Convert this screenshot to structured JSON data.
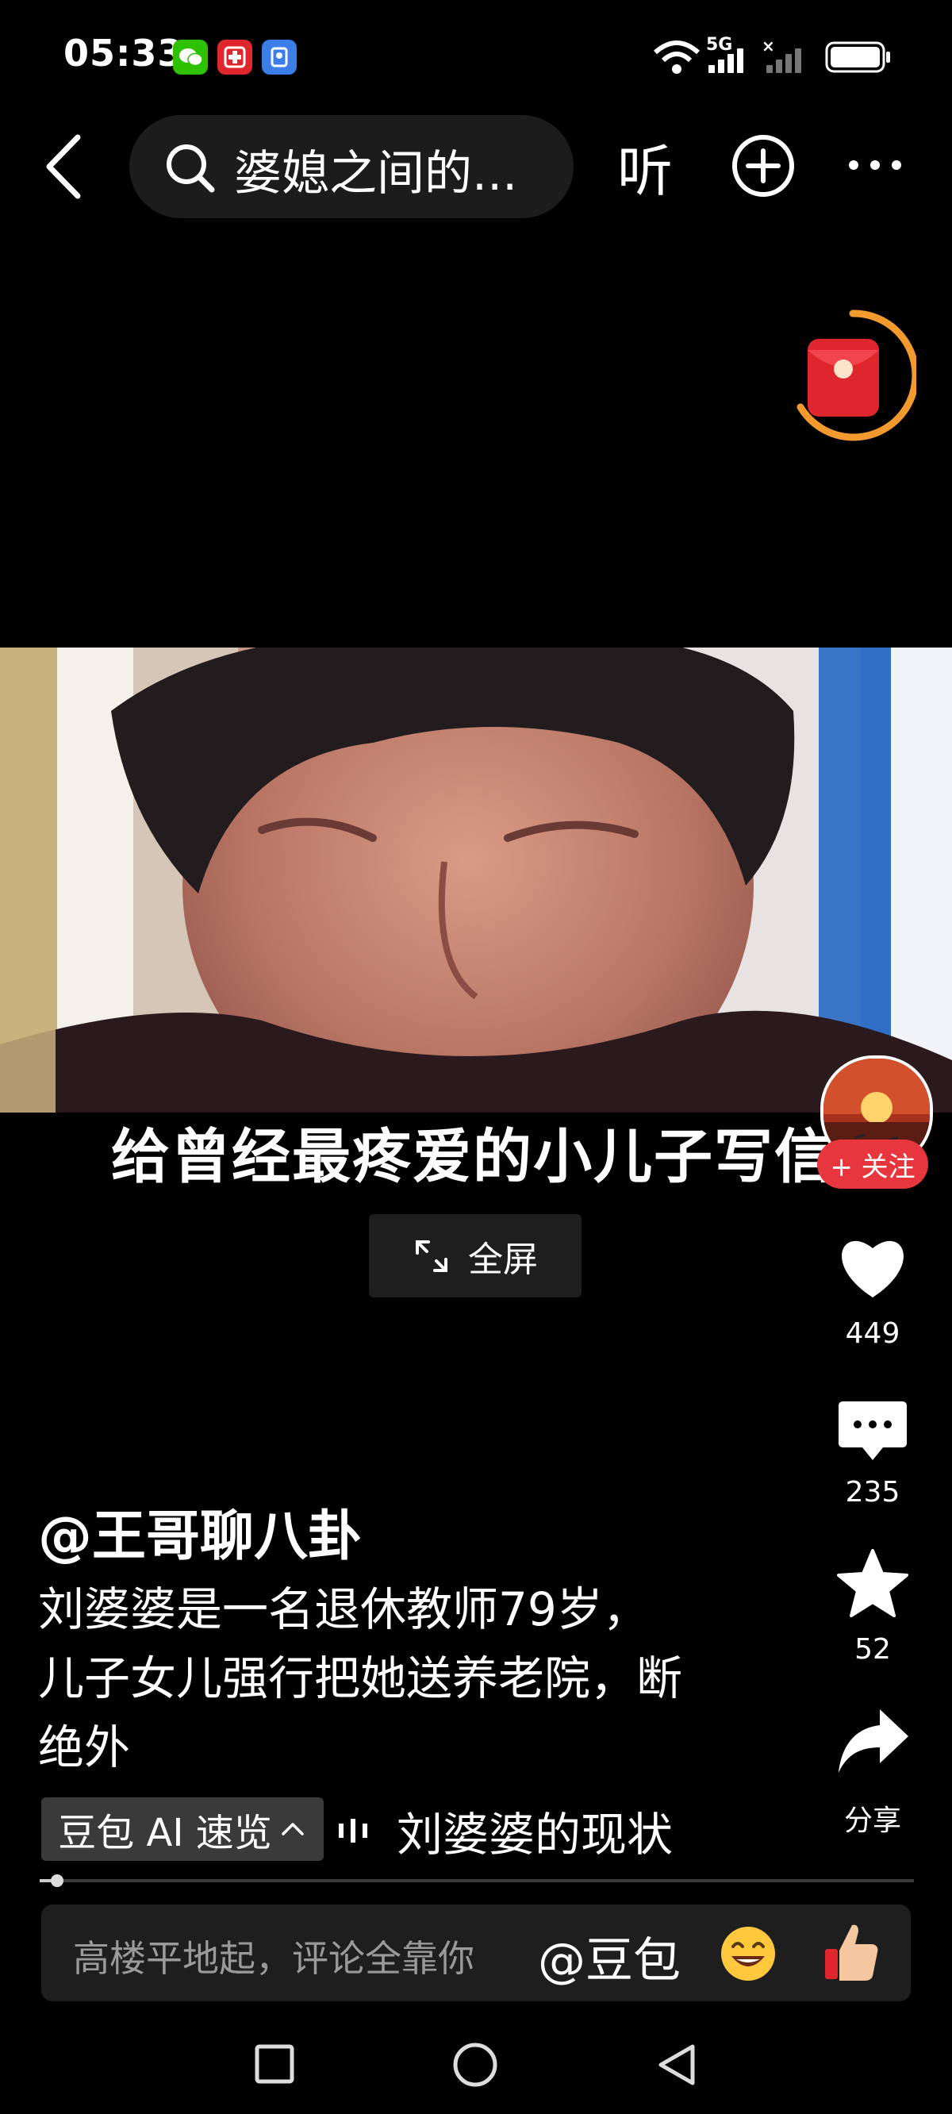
{
  "status_bar": {
    "time": "05:33",
    "network": "5G"
  },
  "top_bar": {
    "search_text": "婆媳之间的...",
    "listen_label": "听"
  },
  "video": {
    "subtitle": "给曾经最疼爱的小儿子写信",
    "fullscreen_label": "全屏"
  },
  "right_rail": {
    "follow_label": "+ 关注",
    "likes": "449",
    "comments": "235",
    "favorites": "52",
    "share_label": "分享"
  },
  "description": {
    "author": "@王哥聊八卦",
    "lines": [
      "刘婆婆是一名退休教师79岁，",
      "儿子女儿强行把她送养老院，断",
      "绝外"
    ],
    "ai_tag": "豆包 AI 速览",
    "ai_summary": "刘婆婆的现状"
  },
  "playback": {
    "progress": 0.02
  },
  "comment_bar": {
    "placeholder": "高楼平地起，评论全靠你",
    "mention": "@豆包"
  },
  "colors": {
    "accent_red": "#e8363f",
    "timer_ring": "#f29a2e",
    "wechat_green": "#2dc100"
  }
}
